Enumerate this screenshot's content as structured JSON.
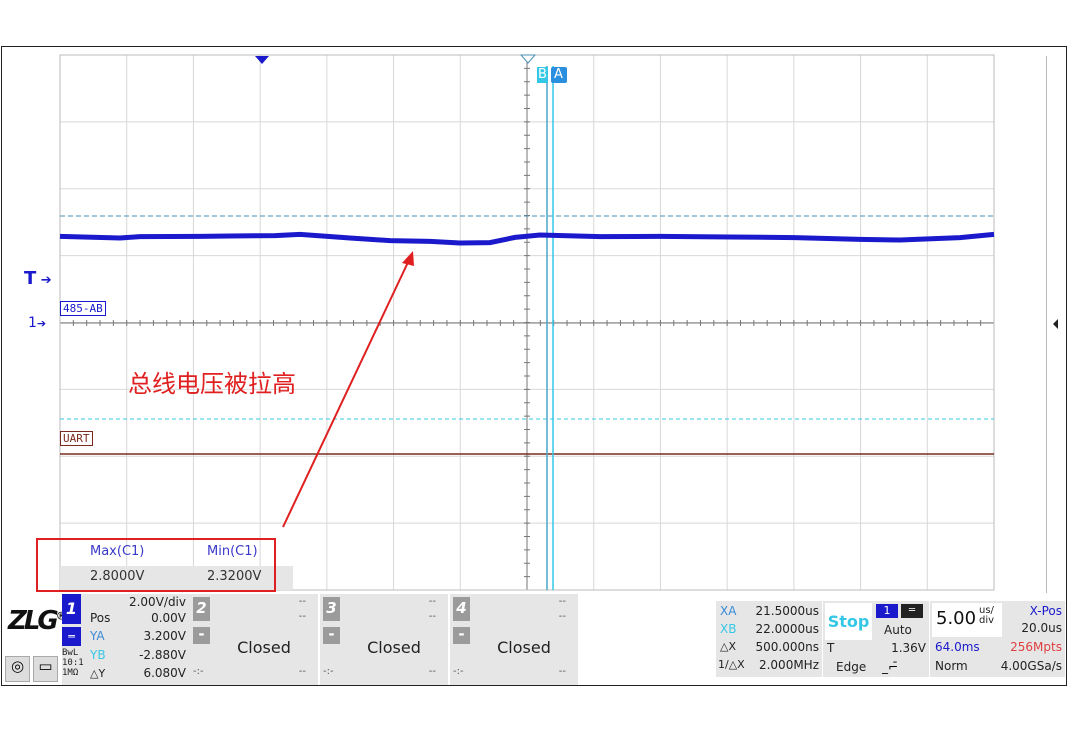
{
  "annotation": {
    "text": "总线电压被拉高",
    "color": "#e02020"
  },
  "colors": {
    "ch1": "#1a1acc",
    "cursor": "#35c8e6",
    "uart": "#7a2b1e",
    "highlight": "#e02020"
  },
  "plot": {
    "trigger_label": "T",
    "ch1_marker": "1",
    "ch1_label": "485-AB",
    "bus_label": "UART",
    "cursor_b": "B",
    "cursor_a": "A"
  },
  "measurements": {
    "headers": [
      "Max(C1)",
      "Min(C1)"
    ],
    "values": [
      "2.8000V",
      "2.3200V"
    ]
  },
  "logo": "ZLG",
  "channel1": {
    "number": "1",
    "scale": "2.00V/div",
    "pos_label": "Pos",
    "pos_value": "0.00V",
    "coupling_icon": "dc-coupling-icon",
    "bwl": "BwL",
    "probe": "10:1",
    "impedance": "1MΩ",
    "ya_label": "YA",
    "ya_value": "3.200V",
    "yb_label": "YB",
    "yb_value": "-2.880V",
    "dy_label": "△Y",
    "dy_value": "6.080V"
  },
  "channels": [
    {
      "number": "2",
      "minus": "-",
      "top1": "--",
      "top2": "--",
      "status": "Closed",
      "bl": "-:-",
      "br": "--"
    },
    {
      "number": "3",
      "minus": "-",
      "top1": "--",
      "top2": "--",
      "status": "Closed",
      "bl": "-:-",
      "br": "--"
    },
    {
      "number": "4",
      "minus": "-",
      "top1": "--",
      "top2": "--",
      "status": "Closed",
      "bl": "-:-",
      "br": "--"
    }
  ],
  "cursors": {
    "xa_label": "XA",
    "xa_value": "21.5000us",
    "xb_label": "XB",
    "xb_value": "22.0000us",
    "dx_label": "△X",
    "dx_value": "500.000ns",
    "inv_label": "1/△X",
    "inv_value": "2.000MHz"
  },
  "acquisition": {
    "run_state": "Stop",
    "trig_source": "1",
    "trig_mode": "Auto",
    "trig_level_label": "T",
    "trig_level": "1.36V",
    "trig_type": "Edge"
  },
  "timebase": {
    "scale": "5.00",
    "unit_top": "us/",
    "unit_bottom": "div",
    "xpos_label": "X-Pos",
    "xpos_value": "20.0us",
    "record_time": "64.0ms",
    "memory_depth": "256Mpts",
    "acq_mode": "Norm",
    "sample_rate": "4.00GSa/s"
  }
}
